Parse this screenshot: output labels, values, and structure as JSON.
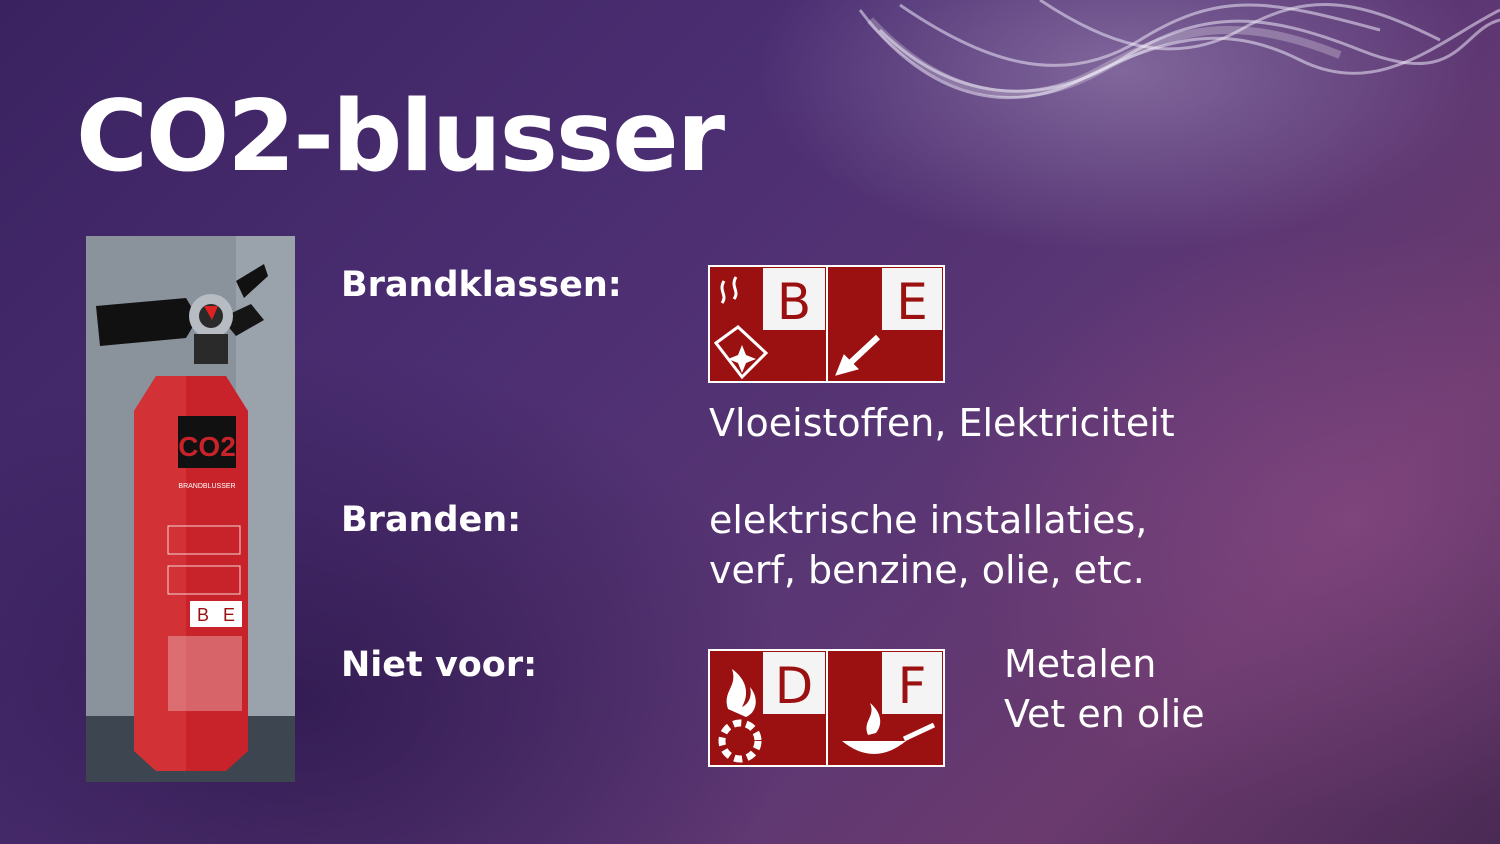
{
  "slide": {
    "title": "CO2-blusser",
    "extinguisher": {
      "label": "CO2",
      "brand_text": "BRANDBLUSSER",
      "classes": [
        "B",
        "E"
      ]
    },
    "rows": {
      "brandklassen": {
        "label": "Brandklassen:",
        "classes": [
          "B",
          "E"
        ],
        "description": "Vloeistoffen, Elektriciteit"
      },
      "branden": {
        "label": "Branden:",
        "lines": [
          "elektrische installaties,",
          "verf, benzine, olie, etc."
        ]
      },
      "niet_voor": {
        "label": "Niet voor:",
        "classes": [
          "D",
          "F"
        ],
        "lines": [
          "Metalen",
          "Vet en olie"
        ]
      }
    },
    "colors": {
      "sign_red": "#9b1010",
      "extinguisher_red": "#c8232a",
      "text": "#ffffff"
    }
  }
}
